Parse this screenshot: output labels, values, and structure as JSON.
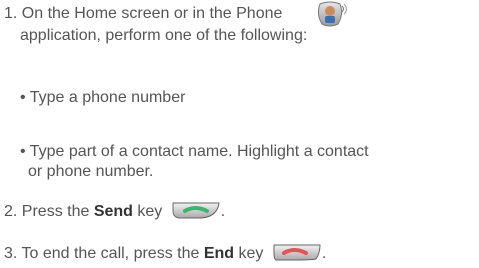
{
  "steps": [
    {
      "num": "1.",
      "line1": "On the Home screen or in the Phone",
      "line2": "application, perform one of the following:",
      "icon": "phone-app-icon"
    },
    {
      "bullet": "• Type a phone number"
    },
    {
      "bullet_line1": "• Type part of a contact name. Highlight a contact",
      "bullet_line2": "or phone number."
    },
    {
      "num": "2.",
      "prefix": "Press the ",
      "bold": "Send",
      "suffix": " key",
      "tail": ".",
      "icon": "send-key-icon",
      "key_color": "#3cb371"
    },
    {
      "num": "3.",
      "prefix": "To end the call, press the ",
      "bold": "End",
      "suffix": " key",
      "tail": ".",
      "icon": "end-key-icon",
      "key_color": "#e05555"
    }
  ]
}
